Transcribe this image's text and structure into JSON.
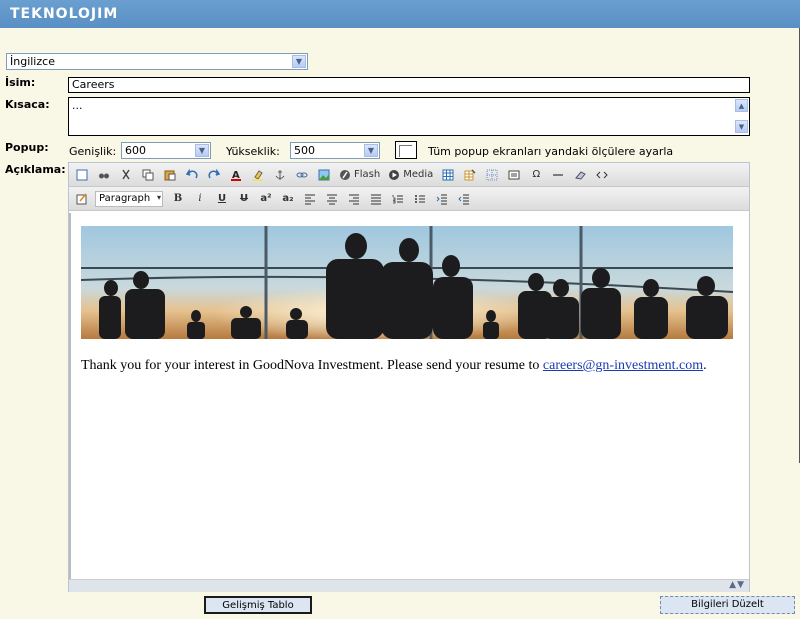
{
  "app": {
    "logo": "TEKNOLOJIM"
  },
  "language": {
    "selected": "İngilizce"
  },
  "form": {
    "isim_label": "İsim:",
    "isim_value": "Careers",
    "kisaca_label": "Kısaca:",
    "kisaca_value": "...",
    "popup_label": "Popup:",
    "genislik_label": "Genişlik:",
    "genislik_value": "600",
    "yukseklik_label": "Yükseklik:",
    "yukseklik_value": "500",
    "checkbox_label": "Tüm popup ekranları yandaki ölçülere ayarla",
    "aciklama_label": "Açıklama:"
  },
  "editor": {
    "flash_label": "Flash",
    "media_label": "Media",
    "omega_label": "Ω",
    "format_select": "Paragraph",
    "bold": "B",
    "italic": "i",
    "underline": "U",
    "strike": "U",
    "sup": "a²",
    "sub": "a₂",
    "content_text": "Thank you for your interest in GoodNova Investment. Please send your resume to ",
    "content_link": "careers@gn-investment.com",
    "content_end": "."
  },
  "buttons": {
    "gelismis_tablo": "Gelişmiş Tablo",
    "bilgileri_duzelt": "Bilgileri Düzelt"
  },
  "colors": {
    "header": "#5a8fc4",
    "background": "#f9f7e6",
    "link": "#1a3ab0"
  }
}
